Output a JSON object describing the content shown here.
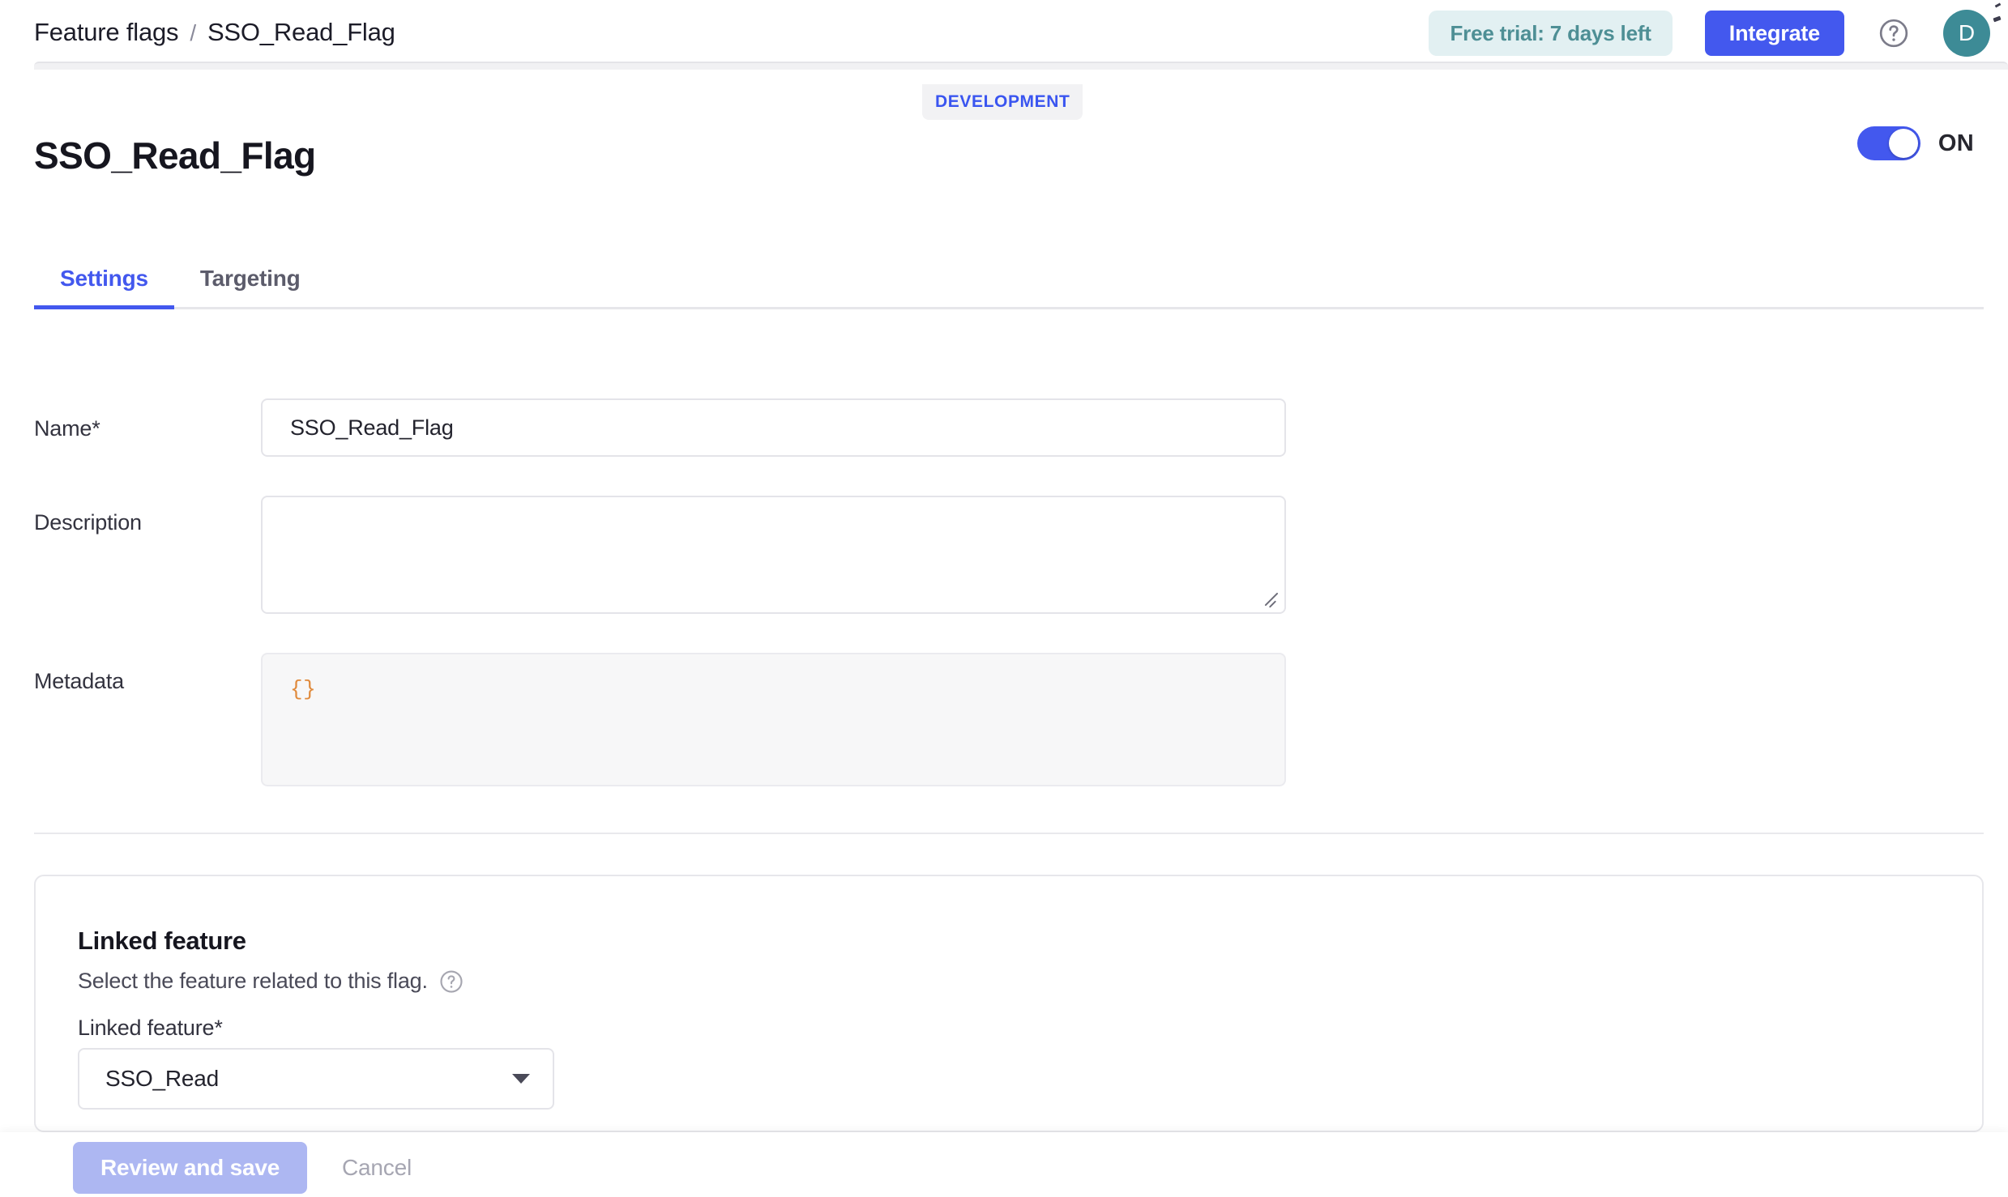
{
  "header": {
    "breadcrumb": {
      "root": "Feature flags",
      "separator": "/",
      "current": "SSO_Read_Flag"
    },
    "trial_badge": "Free trial: 7 days left",
    "integrate_button": "Integrate",
    "help_icon": "question-circle-icon",
    "avatar_initial": "D"
  },
  "page": {
    "environment_badge": "DEVELOPMENT",
    "title": "SSO_Read_Flag",
    "toggle_state_label": "ON",
    "toggle_on": true
  },
  "tabs": [
    {
      "label": "Settings",
      "active": true
    },
    {
      "label": "Targeting",
      "active": false
    }
  ],
  "form": {
    "name": {
      "label": "Name",
      "required_marker": "*",
      "value": "SSO_Read_Flag",
      "placeholder": ""
    },
    "description": {
      "label": "Description",
      "value": "",
      "placeholder": ""
    },
    "metadata": {
      "label": "Metadata",
      "value": "{}"
    }
  },
  "linked_feature_card": {
    "title": "Linked feature",
    "subtitle": "Select the feature related to this flag.",
    "subtitle_help_icon": "question-circle-icon",
    "field_label": "Linked feature",
    "field_required_marker": "*",
    "selected_option": "SSO_Read",
    "caret_icon": "chevron-down-icon"
  },
  "footer": {
    "primary_button": "Review and save",
    "primary_button_disabled": true,
    "cancel_button": "Cancel"
  },
  "colors": {
    "accent_blue": "#4358ee",
    "accent_blue_disabled": "#adb7f2",
    "trial_text": "#4e8f95",
    "trial_bg": "#e2f0f2",
    "avatar_bg": "#3d8b96",
    "metadata_code": "#e08a3c",
    "border": "#e4e4e9"
  }
}
